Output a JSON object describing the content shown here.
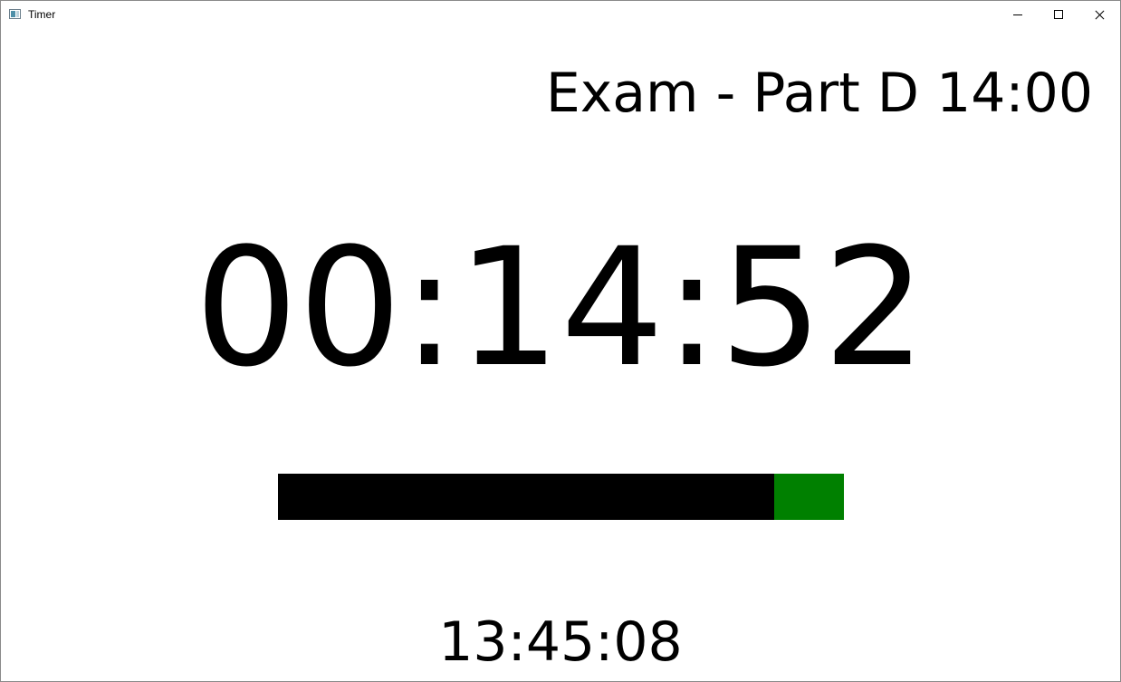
{
  "window": {
    "title": "Timer",
    "icon": "timer-app-icon",
    "controls": {
      "minimize_icon": "minimize-icon",
      "maximize_icon": "maximize-icon",
      "close_icon": "close-icon"
    }
  },
  "session": {
    "label": "Exam - Part D 14:00"
  },
  "countdown": {
    "value": "00:14:52"
  },
  "progress": {
    "elapsed_fraction": 0.876,
    "elapsed_color": "#000000",
    "remaining_color": "#008000"
  },
  "clock": {
    "value": "13:45:08"
  }
}
